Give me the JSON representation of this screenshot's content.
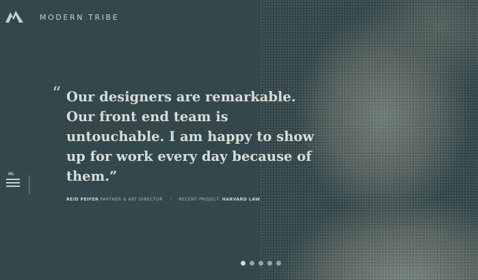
{
  "header": {
    "brand": "MODERN TRIBE",
    "logo_icon": "mountain-logo-icon"
  },
  "nav": {
    "hi_label": "HI.",
    "menu_icon": "hamburger-menu-icon"
  },
  "testimonial": {
    "open_quote": "“",
    "lines": [
      "Our designers are remarkable.",
      "Our front end team is",
      "untouchable. I am happy to show",
      "up for work every day because of",
      "them.”"
    ],
    "person_name": "REID PEIFER",
    "person_role": "PARTNER & ART DIRECTOR",
    "separator": "\\",
    "project_label": "RECENT PROJECT:",
    "project_name": "HARVARD LAW"
  },
  "slider": {
    "dot_count": 5,
    "active_index": 0
  },
  "colors": {
    "background": "#34474a",
    "text": "#d6ddd9"
  }
}
